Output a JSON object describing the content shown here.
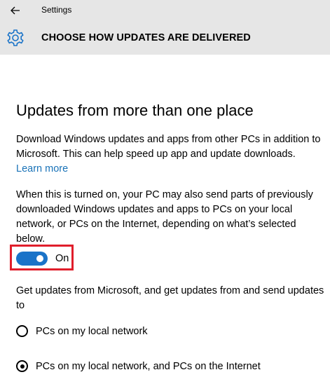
{
  "window": {
    "app_title": "Settings",
    "back_icon": "back-arrow-icon"
  },
  "header": {
    "title": "CHOOSE HOW UPDATES ARE DELIVERED",
    "icon": "gear-icon"
  },
  "main": {
    "heading": "Updates from more than one place",
    "description": "Download Windows updates and apps from other PCs in addition to Microsoft. This can help speed up app and update downloads.",
    "learn_more": "Learn more",
    "detail": "When this is turned on, your PC may also send parts of previously downloaded Windows updates and apps to PCs on your local network, or PCs on the Internet, depending on what’s selected below.",
    "toggle": {
      "state": "On",
      "is_on": true,
      "color": "#1a73c8"
    },
    "get_updates_text": "Get updates from Microsoft, and get updates from and send updates to",
    "options": [
      {
        "label": "PCs on my local network",
        "selected": false
      },
      {
        "label": "PCs on my local network, and PCs on the Internet",
        "selected": true
      }
    ]
  },
  "colors": {
    "header_bg": "#e6e6e6",
    "link": "#1a73b8",
    "highlight": "#e01e2b"
  }
}
